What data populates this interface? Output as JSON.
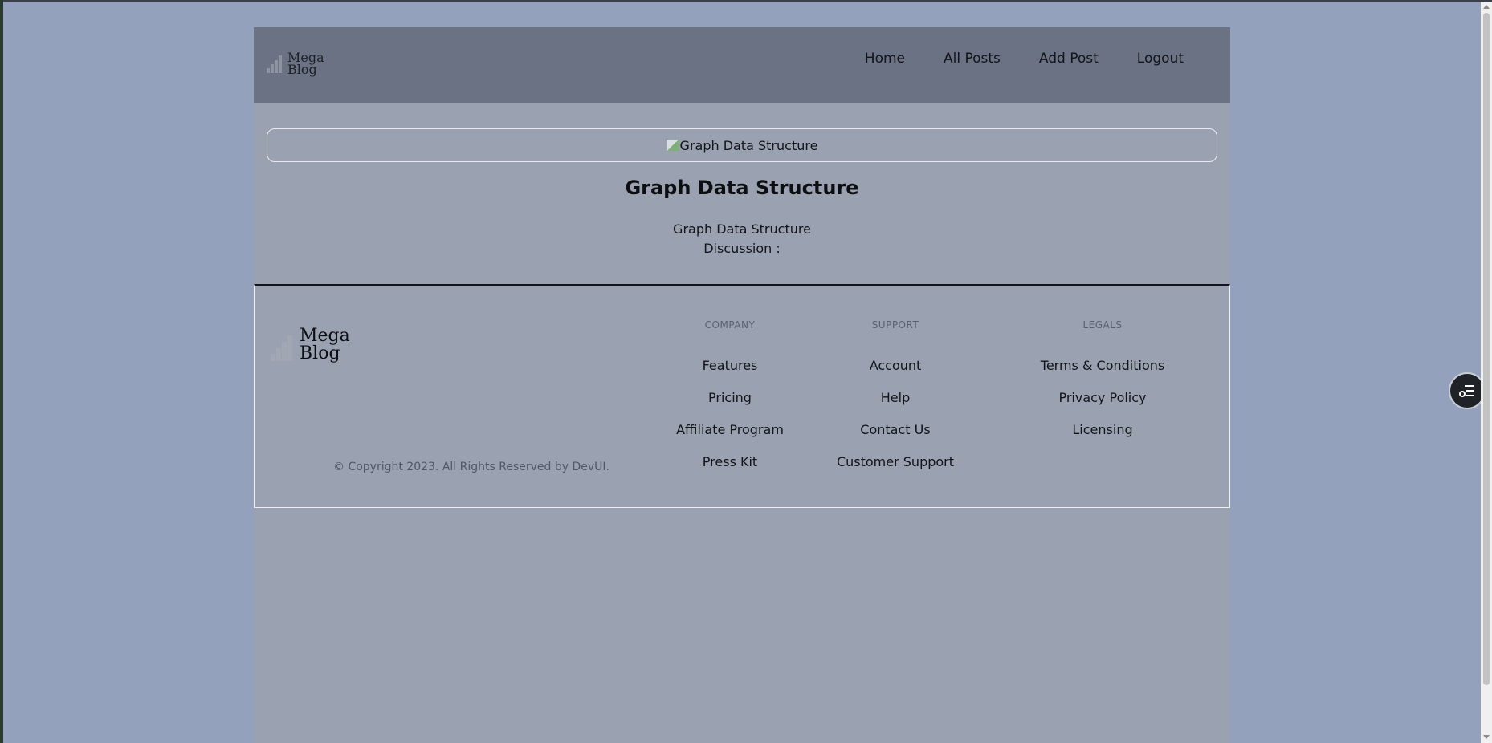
{
  "header": {
    "logo_text": "Mega\nBlog",
    "nav": [
      "Home",
      "All Posts",
      "Add Post",
      "Logout"
    ]
  },
  "post": {
    "image_alt": "Graph Data Structure",
    "title": "Graph Data Structure",
    "body": "Graph Data Structure",
    "discussion": "Discussion :"
  },
  "footer": {
    "logo_text": "Mega\nBlog",
    "copyright": "© Copyright 2023. All Rights Reserved by DevUI.",
    "columns": [
      {
        "heading": "COMPANY",
        "items": [
          "Features",
          "Pricing",
          "Affiliate Program",
          "Press Kit"
        ]
      },
      {
        "heading": "SUPPORT",
        "items": [
          "Account",
          "Help",
          "Contact Us",
          "Customer Support"
        ]
      },
      {
        "heading": "LEGALS",
        "items": [
          "Terms & Conditions",
          "Privacy Policy",
          "Licensing"
        ]
      }
    ]
  },
  "floating_button": {
    "icon": "list-settings-icon"
  },
  "colors": {
    "background": "#94a1bc",
    "header": "#6b7283",
    "page": "#9aa2b1"
  }
}
